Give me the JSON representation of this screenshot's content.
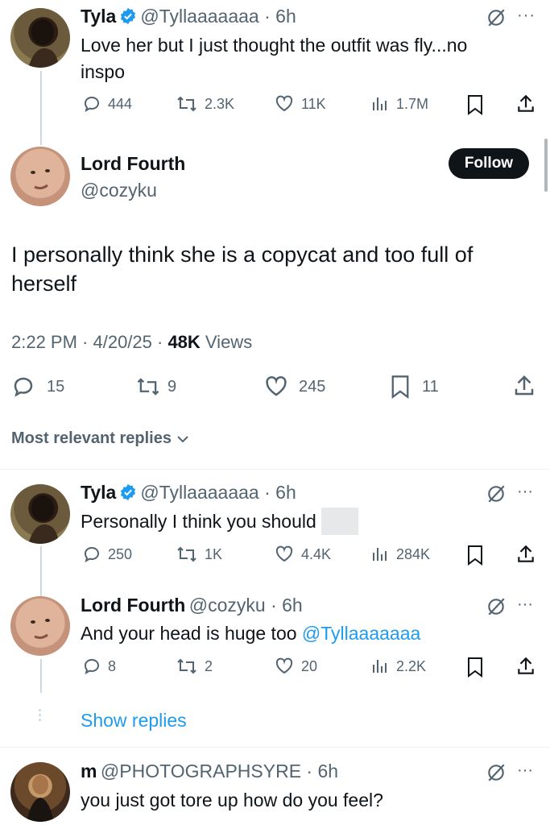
{
  "reply1": {
    "name": "Tyla",
    "handle_time": "@Tyllaaaaaaa · 6h",
    "text_line1": "Love her but I just thought the outfit was fly...no",
    "text_line2": "inspo",
    "replies": "444",
    "reposts": "2.3K",
    "likes": "11K",
    "views": "1.7M"
  },
  "main_tweet": {
    "name": "Lord Fourth",
    "handle": "@cozyku",
    "follow_label": "Follow",
    "text_line1": "I personally think she is a copycat and too full of",
    "text_line2": "herself",
    "timestamp": "2:22 PM · 4/20/25 · ",
    "views_count": "48K",
    "views_label": " Views",
    "replies": "15",
    "reposts": "9",
    "likes": "245",
    "bookmarks": "11"
  },
  "sort": {
    "label": "Most relevant replies"
  },
  "reply2": {
    "name": "Tyla",
    "handle_time": "@Tyllaaaaaaa · 6h",
    "text": "Personally I think you should",
    "replies": "250",
    "reposts": "1K",
    "likes": "4.4K",
    "views": "284K"
  },
  "reply3": {
    "name": "Lord Fourth",
    "handle_time": "@cozyku · 6h",
    "text": "And your head is huge too ",
    "mention": "@Tyllaaaaaaa",
    "replies": "8",
    "reposts": "2",
    "likes": "20",
    "views": "2.2K"
  },
  "show_replies": {
    "label": "Show replies"
  },
  "reply4": {
    "name": "m",
    "handle_time": "@PHOTOGRAPHSYRE · 6h",
    "text": "you just got tore up how do you feel?"
  },
  "colors": {
    "accent": "#1d9bf0",
    "text": "#0f1419",
    "muted": "#536471"
  }
}
